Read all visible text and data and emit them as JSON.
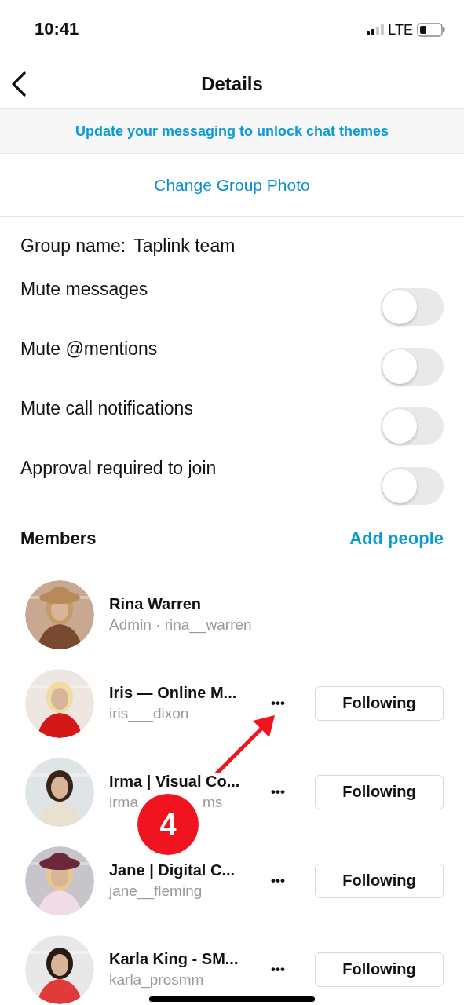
{
  "status_bar": {
    "time": "10:41",
    "network": "LTE"
  },
  "nav": {
    "title": "Details"
  },
  "banner": {
    "text": "Update your messaging to unlock chat themes"
  },
  "change_photo": {
    "label": "Change Group Photo"
  },
  "group_name": {
    "label": "Group name:",
    "value": "Taplink team"
  },
  "settings": [
    {
      "label": "Mute messages",
      "on": false
    },
    {
      "label": "Mute @mentions",
      "on": false
    },
    {
      "label": "Mute call notifications",
      "on": false
    },
    {
      "label": "Approval required to join",
      "on": false
    }
  ],
  "members_header": {
    "title": "Members",
    "action": "Add people"
  },
  "members": [
    {
      "name": "Rina Warren",
      "handle": "Admin · rina__warren"
    },
    {
      "name": "Iris — Online M...",
      "handle": "iris___dixon",
      "more": "•••",
      "button": "Following"
    },
    {
      "name": "Irma | Visual Co...",
      "handle": "irma",
      "handle_end": "ms",
      "more": "•••",
      "button": "Following"
    },
    {
      "name": "Jane | Digital C...",
      "handle": "jane__fleming",
      "more": "•••",
      "button": "Following"
    },
    {
      "name": "Karla King - SM...",
      "handle": "karla_prosmm",
      "more": "•••",
      "button": "Following"
    }
  ],
  "annotation": {
    "number": "4"
  }
}
